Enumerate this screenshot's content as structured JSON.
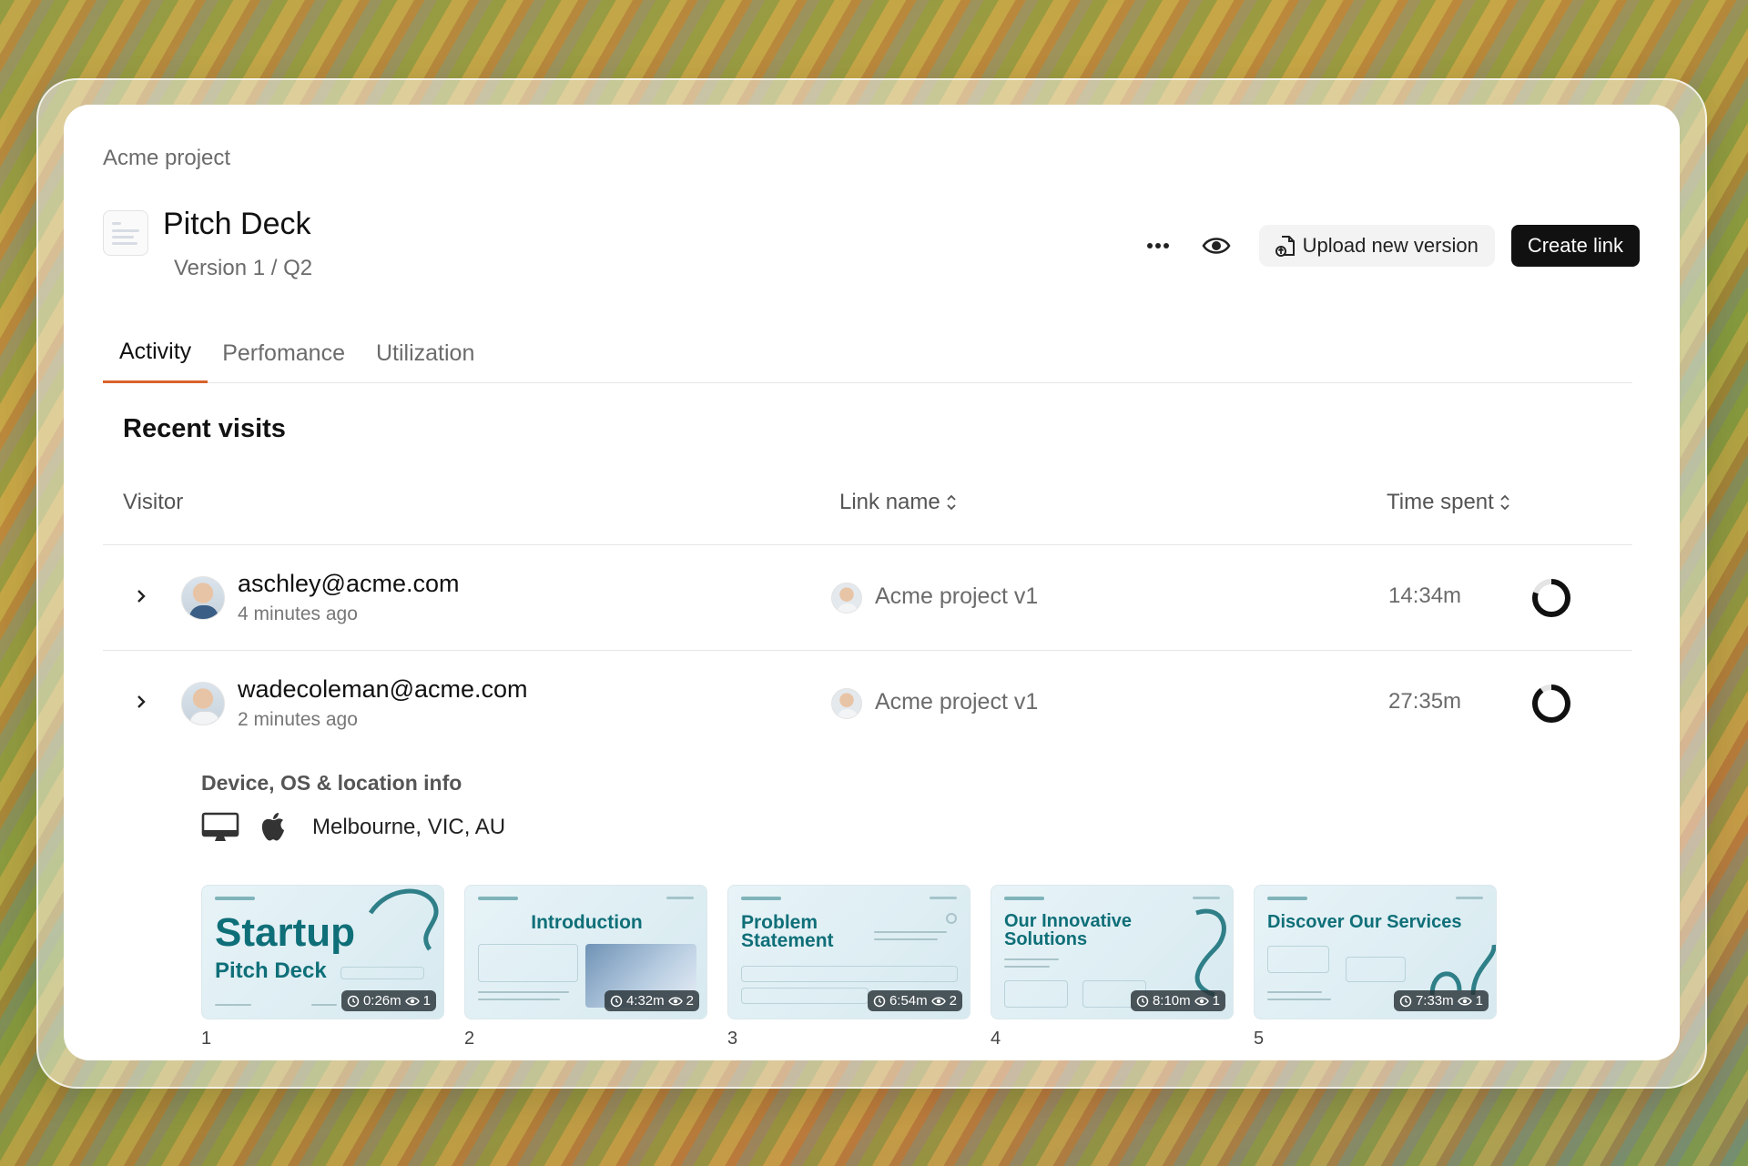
{
  "project": "Acme project",
  "document": {
    "title": "Pitch Deck",
    "version": "Version 1 / Q2"
  },
  "actions": {
    "more_icon": "more-horizontal-icon",
    "preview_icon": "eye-icon",
    "upload_label": "Upload new version",
    "upload_icon": "file-upload-icon",
    "create_label": "Create link"
  },
  "tabs": [
    {
      "label": "Activity",
      "active": true
    },
    {
      "label": "Perfomance",
      "active": false
    },
    {
      "label": "Utilization",
      "active": false
    }
  ],
  "section_title": "Recent visits",
  "columns": {
    "visitor": "Visitor",
    "link_name": "Link name",
    "time_spent": "Time spent"
  },
  "visits": [
    {
      "email": "aschley@acme.com",
      "ago": "4 minutes ago",
      "link": "Acme project v1",
      "time": "14:34m",
      "progress": 0.8
    },
    {
      "email": "wadecoleman@acme.com",
      "ago": "2 minutes ago",
      "link": "Acme project v1",
      "time": "27:35m",
      "progress": 0.9
    }
  ],
  "device": {
    "title": "Device, OS & location info",
    "device_icon": "desktop-icon",
    "os_icon": "apple-icon",
    "location": "Melbourne, VIC, AU"
  },
  "slides": [
    {
      "num": "1",
      "title_line1": "Startup",
      "title_line2": "Pitch Deck",
      "time": "0:26m",
      "views": "1"
    },
    {
      "num": "2",
      "title_line1": "Introduction",
      "title_line2": "",
      "time": "4:32m",
      "views": "2"
    },
    {
      "num": "3",
      "title_line1": "Problem",
      "title_line2": "Statement",
      "time": "6:54m",
      "views": "2"
    },
    {
      "num": "4",
      "title_line1": "Our Innovative",
      "title_line2": "Solutions",
      "time": "8:10m",
      "views": "1"
    },
    {
      "num": "5",
      "title_line1": "Discover Our Services",
      "title_line2": "",
      "time": "7:33m",
      "views": "1"
    }
  ],
  "colors": {
    "accent": "#d9622b",
    "primary_button": "#111111",
    "slide_teal": "#0f6f78"
  }
}
